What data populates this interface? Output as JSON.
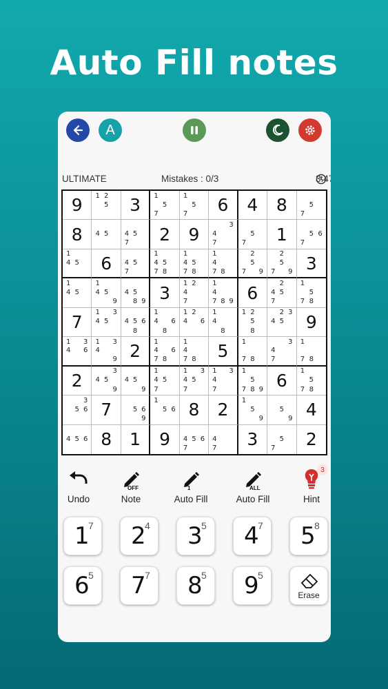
{
  "headline": "Auto Fill notes",
  "colors": {
    "back": "#2447a8",
    "account": "#17a2a8",
    "pause": "#5a9a56",
    "dark": "#1c5230",
    "settings": "#d23a2e"
  },
  "topbar": {
    "account_letter": "A"
  },
  "status": {
    "difficulty": "ULTIMATE",
    "mistakes": "Mistakes : 0/3",
    "timer": "3:47"
  },
  "board": [
    [
      {
        "v": "9"
      },
      {
        "n": [
          "1",
          "2",
          "",
          "",
          "5",
          "",
          "",
          "",
          ""
        ]
      },
      {
        "v": "3"
      },
      {
        "n": [
          "1",
          "",
          "",
          "",
          "5",
          "",
          "7",
          "",
          ""
        ]
      },
      {
        "n": [
          "1",
          "",
          "",
          "",
          "5",
          "",
          "7",
          "",
          ""
        ]
      },
      {
        "v": "6"
      },
      {
        "v": "4"
      },
      {
        "v": "8"
      },
      {
        "n": [
          "",
          "",
          "",
          "",
          "5",
          "",
          "7",
          "",
          ""
        ]
      }
    ],
    [
      {
        "v": "8"
      },
      {
        "n": [
          "",
          "",
          "",
          "4",
          "5",
          "",
          "",
          "",
          ""
        ]
      },
      {
        "n": [
          "",
          "",
          "",
          "4",
          "5",
          "",
          "7",
          "",
          ""
        ]
      },
      {
        "v": "2"
      },
      {
        "v": "9"
      },
      {
        "n": [
          "",
          "",
          "3",
          "4",
          "",
          "",
          "7",
          "",
          ""
        ]
      },
      {
        "n": [
          "",
          "",
          "",
          "",
          "5",
          "",
          "7",
          "",
          ""
        ]
      },
      {
        "v": "1"
      },
      {
        "n": [
          "",
          "",
          "",
          "",
          "5",
          "6",
          "7",
          "",
          ""
        ]
      }
    ],
    [
      {
        "n": [
          "1",
          "",
          "",
          "4",
          "5",
          "",
          "",
          "",
          ""
        ]
      },
      {
        "v": "6"
      },
      {
        "n": [
          "",
          "",
          "",
          "4",
          "5",
          "",
          "7",
          "",
          ""
        ]
      },
      {
        "n": [
          "1",
          "",
          "",
          "4",
          "5",
          "",
          "7",
          "8",
          ""
        ]
      },
      {
        "n": [
          "1",
          "",
          "",
          "4",
          "5",
          "",
          "7",
          "8",
          ""
        ]
      },
      {
        "n": [
          "1",
          "",
          "",
          "4",
          "",
          "",
          "7",
          "8",
          ""
        ]
      },
      {
        "n": [
          "",
          "2",
          "",
          "",
          "5",
          "",
          "7",
          "",
          "9"
        ]
      },
      {
        "n": [
          "",
          "2",
          "",
          "",
          "5",
          "",
          "7",
          "",
          "9"
        ]
      },
      {
        "v": "3"
      }
    ],
    [
      {
        "n": [
          "1",
          "",
          "",
          "4",
          "5",
          "",
          "",
          "",
          ""
        ]
      },
      {
        "n": [
          "1",
          "",
          "",
          "4",
          "5",
          "",
          "",
          "",
          "9"
        ]
      },
      {
        "n": [
          "",
          "",
          "",
          "4",
          "5",
          "",
          "",
          "8",
          "9"
        ]
      },
      {
        "v": "3"
      },
      {
        "n": [
          "1",
          "2",
          "",
          "4",
          "",
          "",
          "7",
          "",
          ""
        ]
      },
      {
        "n": [
          "1",
          "",
          "",
          "4",
          "",
          "",
          "7",
          "8",
          "9"
        ]
      },
      {
        "v": "6"
      },
      {
        "n": [
          "",
          "2",
          "",
          "4",
          "5",
          "",
          "7",
          "",
          ""
        ]
      },
      {
        "n": [
          "1",
          "",
          "",
          "",
          "5",
          "",
          "7",
          "8",
          ""
        ]
      }
    ],
    [
      {
        "v": "7"
      },
      {
        "n": [
          "1",
          "",
          "3",
          "4",
          "5",
          "",
          "",
          "",
          ""
        ]
      },
      {
        "n": [
          "",
          "",
          "",
          "4",
          "5",
          "6",
          "",
          "8",
          ""
        ]
      },
      {
        "n": [
          "1",
          "",
          "",
          "4",
          "",
          "6",
          "",
          "8",
          ""
        ]
      },
      {
        "n": [
          "1",
          "2",
          "",
          "4",
          "",
          "6",
          "",
          "",
          ""
        ]
      },
      {
        "n": [
          "1",
          "",
          "",
          "4",
          "",
          "",
          "",
          "8",
          ""
        ]
      },
      {
        "n": [
          "1",
          "2",
          "",
          "",
          "5",
          "",
          "",
          "8",
          ""
        ]
      },
      {
        "n": [
          "",
          "2",
          "3",
          "4",
          "5",
          "",
          "",
          "",
          ""
        ]
      },
      {
        "v": "9"
      }
    ],
    [
      {
        "n": [
          "1",
          "",
          "3",
          "4",
          "",
          "6",
          "",
          "",
          ""
        ]
      },
      {
        "n": [
          "1",
          "",
          "3",
          "4",
          "",
          "",
          "",
          "",
          "9"
        ]
      },
      {
        "v": "2"
      },
      {
        "n": [
          "1",
          "",
          "",
          "4",
          "",
          "6",
          "7",
          "8",
          ""
        ]
      },
      {
        "n": [
          "1",
          "",
          "",
          "4",
          "",
          "",
          "7",
          "8",
          ""
        ]
      },
      {
        "v": "5"
      },
      {
        "n": [
          "1",
          "",
          "",
          "",
          "",
          "",
          "7",
          "8",
          ""
        ]
      },
      {
        "n": [
          "",
          "",
          "3",
          "4",
          "",
          "",
          "7",
          "",
          ""
        ]
      },
      {
        "n": [
          "1",
          "",
          "",
          "",
          "",
          "",
          "7",
          "8",
          ""
        ]
      }
    ],
    [
      {
        "v": "2"
      },
      {
        "n": [
          "",
          "",
          "3",
          "4",
          "5",
          "",
          "",
          "",
          "9"
        ]
      },
      {
        "n": [
          "",
          "",
          "",
          "4",
          "5",
          "",
          "",
          "",
          "9"
        ]
      },
      {
        "n": [
          "1",
          "",
          "",
          "4",
          "5",
          "",
          "7",
          "",
          ""
        ]
      },
      {
        "n": [
          "1",
          "",
          "3",
          "4",
          "5",
          "",
          "7",
          "",
          ""
        ]
      },
      {
        "n": [
          "1",
          "",
          "3",
          "4",
          "",
          "",
          "7",
          "",
          ""
        ]
      },
      {
        "n": [
          "1",
          "",
          "",
          "",
          "5",
          "",
          "7",
          "8",
          "9"
        ]
      },
      {
        "v": "6"
      },
      {
        "n": [
          "1",
          "",
          "",
          "",
          "5",
          "",
          "7",
          "8",
          ""
        ]
      }
    ],
    [
      {
        "n": [
          "",
          "",
          "3",
          "",
          "5",
          "6",
          "",
          "",
          ""
        ]
      },
      {
        "v": "7"
      },
      {
        "n": [
          "",
          "",
          "",
          "",
          "5",
          "6",
          "",
          "",
          "9"
        ]
      },
      {
        "n": [
          "1",
          "",
          "",
          "",
          "5",
          "6",
          "",
          "",
          ""
        ]
      },
      {
        "v": "8"
      },
      {
        "v": "2"
      },
      {
        "n": [
          "1",
          "",
          "",
          "",
          "5",
          "",
          "",
          "",
          "9"
        ]
      },
      {
        "n": [
          "",
          "",
          "",
          "",
          "5",
          "",
          "",
          "",
          "9"
        ]
      },
      {
        "v": "4"
      }
    ],
    [
      {
        "n": [
          "",
          "",
          "",
          "4",
          "5",
          "6",
          "",
          "",
          ""
        ]
      },
      {
        "v": "8"
      },
      {
        "v": "1"
      },
      {
        "v": "9"
      },
      {
        "n": [
          "",
          "",
          "",
          "4",
          "5",
          "6",
          "7",
          "",
          ""
        ]
      },
      {
        "n": [
          "",
          "",
          "",
          "4",
          "",
          "",
          "7",
          "",
          ""
        ]
      },
      {
        "v": "3"
      },
      {
        "n": [
          "",
          "",
          "",
          "",
          "5",
          "",
          "7",
          "",
          ""
        ]
      },
      {
        "v": "2"
      }
    ]
  ],
  "tools": [
    {
      "name": "undo",
      "label": "Undo",
      "tag": ""
    },
    {
      "name": "note",
      "label": "Note",
      "tag": "OFF"
    },
    {
      "name": "auto-fill-single",
      "label": "Auto Fill",
      "tag": "1"
    },
    {
      "name": "auto-fill-all",
      "label": "Auto Fill",
      "tag": "ALL"
    },
    {
      "name": "hint",
      "label": "Hint",
      "tag": "",
      "badge": "3"
    }
  ],
  "keypad": [
    {
      "num": "1",
      "count": "7"
    },
    {
      "num": "2",
      "count": "4"
    },
    {
      "num": "3",
      "count": "5"
    },
    {
      "num": "4",
      "count": "7"
    },
    {
      "num": "5",
      "count": "8"
    },
    {
      "num": "6",
      "count": "5"
    },
    {
      "num": "7",
      "count": "7"
    },
    {
      "num": "8",
      "count": "5"
    },
    {
      "num": "9",
      "count": "5"
    }
  ],
  "erase_label": "Erase"
}
